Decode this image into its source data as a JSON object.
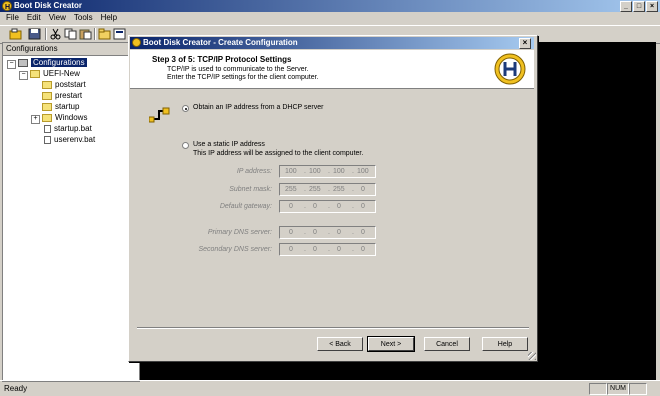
{
  "app": {
    "title": "Boot Disk Creator"
  },
  "window_buttons": {
    "minimize": "_",
    "maximize": "□",
    "close": "×"
  },
  "menu": [
    "File",
    "Edit",
    "View",
    "Tools",
    "Help"
  ],
  "toolbar": {
    "icons": [
      "new-config-icon",
      "save-icon",
      "cut-icon",
      "copy-icon",
      "paste-icon",
      "folder-icon",
      "config-icon",
      "properties-icon",
      "help-icon"
    ]
  },
  "left_pane": {
    "header": "Configurations",
    "tree": [
      {
        "label": "Configurations",
        "level": 0,
        "expanded": true,
        "selected": true
      },
      {
        "label": "UEFI-New",
        "level": 1,
        "expanded": true
      },
      {
        "label": "poststart",
        "level": 2
      },
      {
        "label": "prestart",
        "level": 2
      },
      {
        "label": "startup",
        "level": 2
      },
      {
        "label": "Windows",
        "level": 2,
        "collapsed": true
      },
      {
        "label": "startup.bat",
        "level": 2,
        "file": true
      },
      {
        "label": "userenv.bat",
        "level": 2,
        "file": true
      }
    ]
  },
  "status": {
    "ready": "Ready",
    "num": "NUM"
  },
  "dialog": {
    "title": "Boot Disk Creator - Create Configuration",
    "close": "×",
    "step": "Step 3 of 5: TCP/IP Protocol Settings",
    "desc1": "TCP/IP is used to communicate to the Server.",
    "desc2": "Enter the TCP/IP settings for the client computer.",
    "option_dhcp": "Obtain an IP address from a DHCP server",
    "option_static": "Use a static IP address",
    "option_static_desc": "This IP address will be assigned to the client computer.",
    "fields": {
      "ip_label": "IP address:",
      "ip": [
        "100",
        "100",
        "100",
        "100"
      ],
      "mask_label": "Subnet mask:",
      "mask": [
        "255",
        "255",
        "255",
        "0"
      ],
      "gw_label": "Default gateway:",
      "gw": [
        "0",
        "0",
        "0",
        "0"
      ],
      "dns1_label": "Primary DNS server:",
      "dns1": [
        "0",
        "0",
        "0",
        "0"
      ],
      "dns2_label": "Secondary DNS server:",
      "dns2": [
        "0",
        "0",
        "0",
        "0"
      ]
    },
    "buttons": {
      "back": "< Back",
      "next": "Next >",
      "cancel": "Cancel",
      "help": "Help"
    }
  },
  "colors": {
    "titlebar": "#0a246a",
    "face": "#d4d0c8",
    "client": "#000000"
  }
}
